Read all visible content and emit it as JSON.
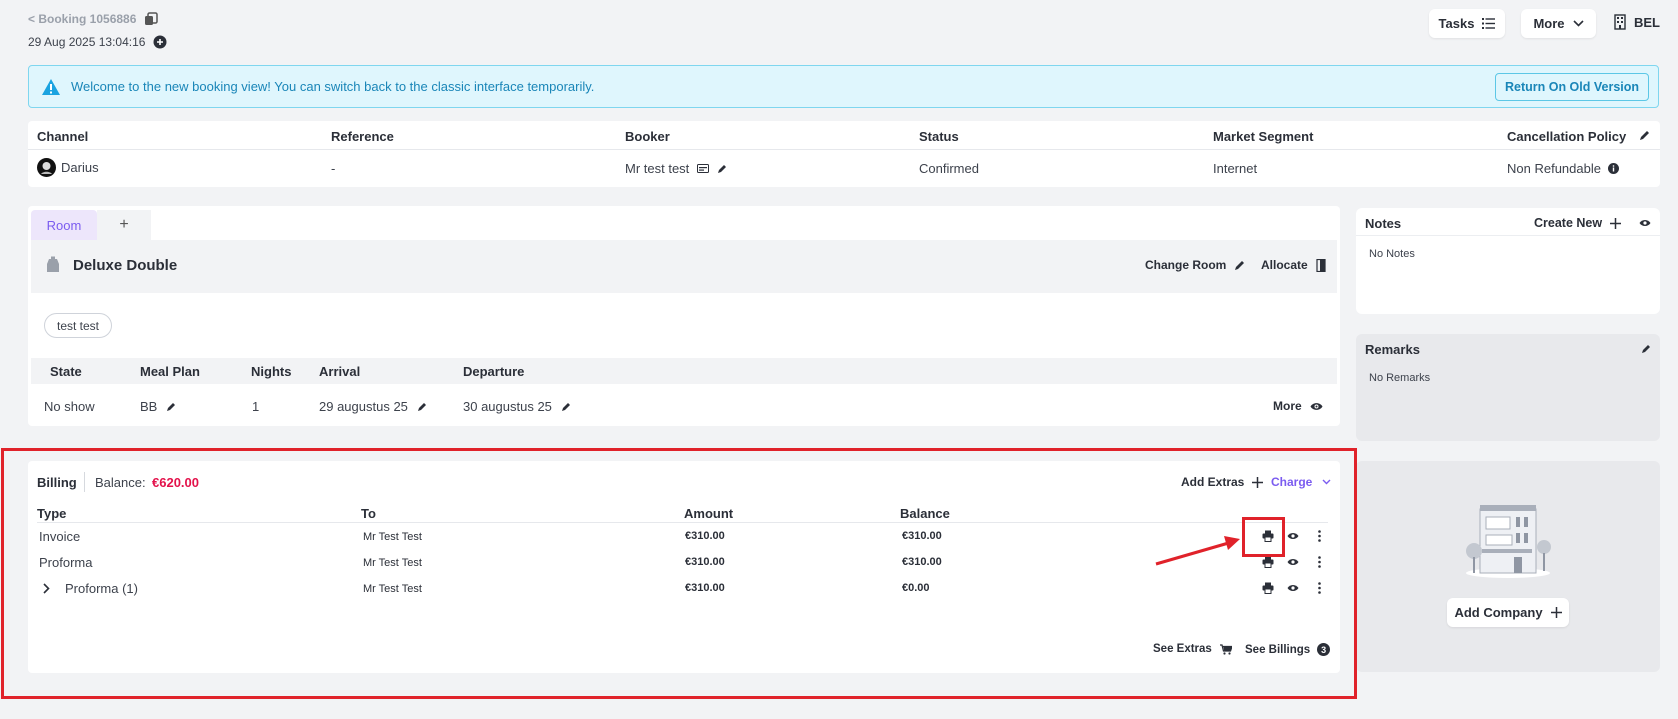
{
  "header": {
    "back_label": "< Booking 1056886",
    "datetime": "29 Aug 2025 13:04:16",
    "tasks_label": "Tasks",
    "more_label": "More",
    "property_code": "BEL"
  },
  "banner": {
    "message": "Welcome to the new booking view! You can switch back to the classic interface temporarily.",
    "button_label": "Return On Old Version"
  },
  "info": {
    "headers": [
      "Channel",
      "Reference",
      "Booker",
      "Status",
      "Market Segment",
      "Cancellation Policy"
    ],
    "channel": "Darius",
    "reference": "-",
    "booker": "Mr test test",
    "status": "Confirmed",
    "market_segment": "Internet",
    "cancellation_policy": "Non Refundable"
  },
  "room": {
    "tab_label": "Room",
    "tab_add": "+",
    "room_name": "Deluxe Double",
    "change_room_label": "Change Room",
    "allocate_label": "Allocate",
    "guest_chip": "test test",
    "columns": [
      "State",
      "Meal Plan",
      "Nights",
      "Arrival",
      "Departure"
    ],
    "state": "No show",
    "meal_plan": "BB",
    "nights": "1",
    "arrival": "29 augustus 25",
    "departure": "30 augustus 25",
    "more_label": "More"
  },
  "notes": {
    "title": "Notes",
    "create_label": "Create New",
    "empty": "No Notes"
  },
  "remarks": {
    "title": "Remarks",
    "empty": "No Remarks"
  },
  "company": {
    "add_label": "Add Company"
  },
  "billing": {
    "title": "Billing",
    "balance_label": "Balance:",
    "balance_value": "€620.00",
    "add_extras_label": "Add Extras",
    "charge_label": "Charge",
    "columns": [
      "Type",
      "To",
      "Amount",
      "Balance"
    ],
    "rows": [
      {
        "type": "Invoice",
        "to": "Mr Test Test",
        "amount": "€310.00",
        "balance": "€310.00"
      },
      {
        "type": "Proforma",
        "to": "Mr Test Test",
        "amount": "€310.00",
        "balance": "€310.00"
      },
      {
        "type": "Proforma (1)",
        "to": "Mr Test Test",
        "amount": "€310.00",
        "balance": "€0.00"
      }
    ],
    "see_extras_label": "See Extras",
    "see_billings_label": "See Billings",
    "billings_count": "3"
  },
  "colors": {
    "accent": "#7b5cf0",
    "balance": "#e3124b",
    "annotation": "#e0222a",
    "banner_bg": "#dff6fd"
  }
}
